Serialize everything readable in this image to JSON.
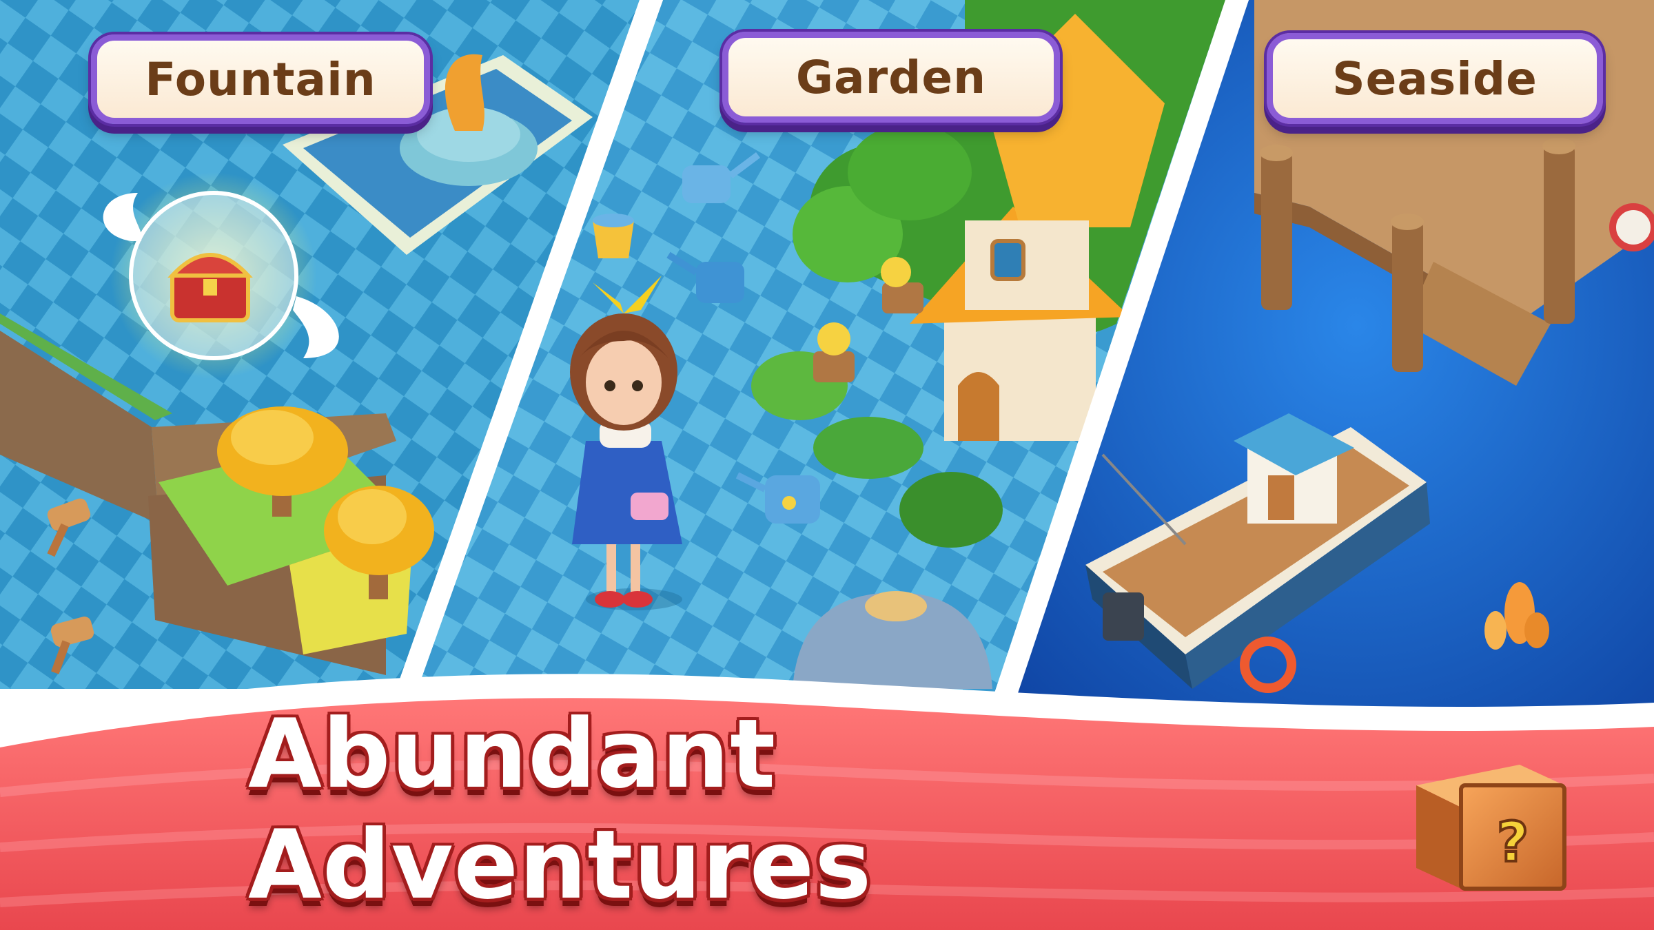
{
  "panels": [
    {
      "label": "Fountain"
    },
    {
      "label": "Garden"
    },
    {
      "label": "Seaside"
    }
  ],
  "banner": {
    "title": "Abundant Adventures"
  },
  "icons": {
    "mystery_box": "mystery-box-icon",
    "chest": "treasure-chest-icon",
    "boat": "fishing-boat-icon"
  },
  "colors": {
    "label_border": "#8b5cd6",
    "label_text": "#6b3d18",
    "banner_red": "#f2575d",
    "water": "#1f6fd0"
  }
}
